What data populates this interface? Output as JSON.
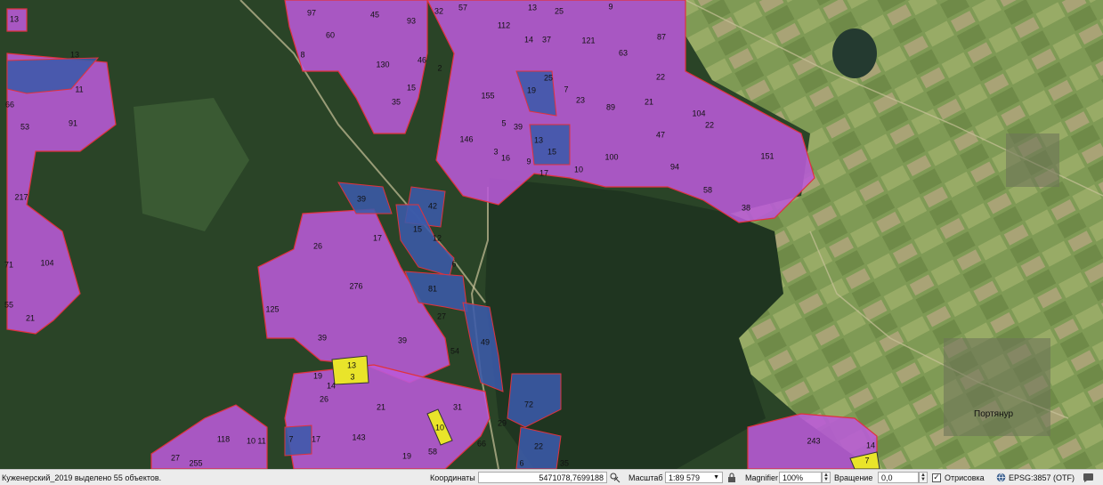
{
  "map": {
    "plots_magenta": [
      {
        "label": "97"
      },
      {
        "label": "45"
      },
      {
        "label": "93"
      },
      {
        "label": "32"
      },
      {
        "label": "57"
      },
      {
        "label": "13"
      },
      {
        "label": "25"
      },
      {
        "label": "9"
      },
      {
        "label": "60"
      },
      {
        "label": "112"
      },
      {
        "label": "14"
      },
      {
        "label": "37"
      },
      {
        "label": "121"
      },
      {
        "label": "87"
      },
      {
        "label": "8"
      },
      {
        "label": "130"
      },
      {
        "label": "46"
      },
      {
        "label": "2"
      },
      {
        "label": "63"
      },
      {
        "label": "25"
      },
      {
        "label": "7"
      },
      {
        "label": "22"
      },
      {
        "label": "15"
      },
      {
        "label": "35"
      },
      {
        "label": "155"
      },
      {
        "label": "23"
      },
      {
        "label": "89"
      },
      {
        "label": "21"
      },
      {
        "label": "104"
      },
      {
        "label": "22"
      },
      {
        "label": "5"
      },
      {
        "label": "39"
      },
      {
        "label": "146"
      },
      {
        "label": "47"
      },
      {
        "label": "3"
      },
      {
        "label": "16"
      },
      {
        "label": "9"
      },
      {
        "label": "100"
      },
      {
        "label": "151"
      },
      {
        "label": "94"
      },
      {
        "label": "17"
      },
      {
        "label": "58"
      },
      {
        "label": "38"
      },
      {
        "label": "13"
      },
      {
        "label": "11"
      },
      {
        "label": "66"
      },
      {
        "label": "91"
      },
      {
        "label": "53"
      },
      {
        "label": "217"
      },
      {
        "label": "104"
      },
      {
        "label": "71"
      },
      {
        "label": "21"
      },
      {
        "label": "55"
      },
      {
        "label": "26"
      },
      {
        "label": "276"
      },
      {
        "label": "125"
      },
      {
        "label": "27"
      },
      {
        "label": "39"
      },
      {
        "label": "39"
      },
      {
        "label": "54"
      },
      {
        "label": "19"
      },
      {
        "label": "14"
      },
      {
        "label": "26"
      },
      {
        "label": "21"
      },
      {
        "label": "31"
      },
      {
        "label": "143"
      },
      {
        "label": "118"
      },
      {
        "label": "10"
      },
      {
        "label": "11"
      },
      {
        "label": "17"
      },
      {
        "label": "19"
      },
      {
        "label": "58"
      },
      {
        "label": "27"
      },
      {
        "label": "255"
      },
      {
        "label": "29"
      },
      {
        "label": "243"
      },
      {
        "label": "14"
      }
    ],
    "plots_blue": [
      {
        "label": "13"
      },
      {
        "label": "19"
      },
      {
        "label": "13"
      },
      {
        "label": "15"
      },
      {
        "label": "10"
      },
      {
        "label": "39"
      },
      {
        "label": "42"
      },
      {
        "label": "15"
      },
      {
        "label": "12"
      },
      {
        "label": "6"
      },
      {
        "label": "17"
      },
      {
        "label": "81"
      },
      {
        "label": "49"
      },
      {
        "label": "72"
      },
      {
        "label": "66"
      },
      {
        "label": "22"
      },
      {
        "label": "7"
      },
      {
        "label": "35"
      },
      {
        "label": "6"
      }
    ],
    "plots_yellow": [
      {
        "label": "13"
      },
      {
        "label": "3"
      },
      {
        "label": "10"
      },
      {
        "label": "7"
      }
    ],
    "place_name": "Портянур",
    "colors": {
      "magenta": "#b95ad8",
      "blue": "#3b5aaa",
      "yellow": "#e9e42a",
      "border": "#e0323c"
    }
  },
  "status": {
    "selection_msg": "Куженерский_2019 выделено 55 объектов.",
    "coords_label": "Координаты",
    "coords_value": "5471078,7699188",
    "scale_label": "Масштаб",
    "scale_value": "1:89 579",
    "magnifier_label": "Magnifier",
    "magnifier_value": "100%",
    "rotation_label": "Вращение",
    "rotation_value": "0,0",
    "render_label": "Отрисовка",
    "render_checked": true,
    "crs_label": "EPSG:3857 (OTF)"
  }
}
